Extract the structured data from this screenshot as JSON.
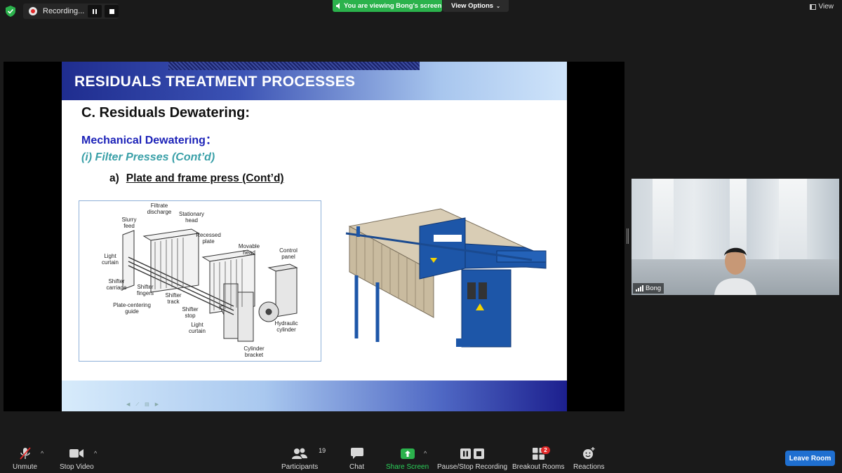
{
  "top_bar": {
    "recording_label": "Recording...",
    "viewing_banner": "You are viewing Bong's screen",
    "view_options_label": "View Options",
    "view_label": "View"
  },
  "slide": {
    "title": "RESIDUALS TREATMENT PROCESSES",
    "heading": "C. Residuals Dewatering:",
    "subheading": "Mechanical Dewatering：",
    "item": "(i) Filter Presses (Cont’d)",
    "subitem_marker": "a)",
    "subitem_text": "Plate and frame press (Cont’d)",
    "diagram_labels": {
      "filtrate_discharge": "Filtrate discharge",
      "stationary_head": "Stationary head",
      "slurry_feed": "Slurry feed",
      "recessed_plate": "Recessed plate",
      "movable_head": "Movable head",
      "control_panel": "Control panel",
      "light_curtain_left": "Light curtain",
      "shifter_carriage": "Shifter carriage",
      "shifter_fingers": "Shifter fingers",
      "shifter_track": "Shifter track",
      "plate_centering_guide": "Plate-centering guide",
      "shifter_stop": "Shifter stop",
      "light_curtain_bottom": "Light curtain",
      "hydraulic_cylinder": "Hydraulic cylinder",
      "cylinder_bracket": "Cylinder bracket"
    }
  },
  "participant_video": {
    "name": "Bong"
  },
  "toolbar": {
    "unmute": "Unmute",
    "stop_video": "Stop Video",
    "participants": "Participants",
    "participants_count": "19",
    "chat": "Chat",
    "share_screen": "Share Screen",
    "pause_stop_recording": "Pause/Stop Recording",
    "breakout_rooms": "Breakout Rooms",
    "breakout_badge": "2",
    "reactions": "Reactions",
    "leave_room": "Leave Room"
  },
  "colors": {
    "share_green": "#2bb24c",
    "leave_blue": "#1f6fd0",
    "slide_blue": "#1c22b8",
    "slide_teal": "#3aa0a8",
    "alert_red": "#e02828"
  }
}
